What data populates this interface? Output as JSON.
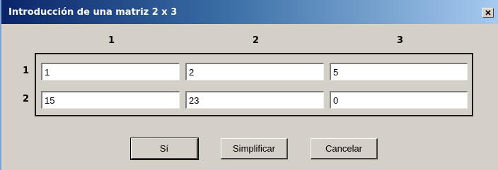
{
  "window": {
    "title": "Introducción de una matriz 2 x 3",
    "close_symbol": "close-icon"
  },
  "matrix": {
    "column_headers": [
      "1",
      "2",
      "3"
    ],
    "row_headers": [
      "1",
      "2"
    ],
    "cells": [
      [
        "1",
        "2",
        "5"
      ],
      [
        "15",
        "23",
        "0"
      ]
    ]
  },
  "buttons": {
    "yes_label": "Sí",
    "simplify_label": "Simplificar",
    "cancel_label": "Cancelar"
  }
}
